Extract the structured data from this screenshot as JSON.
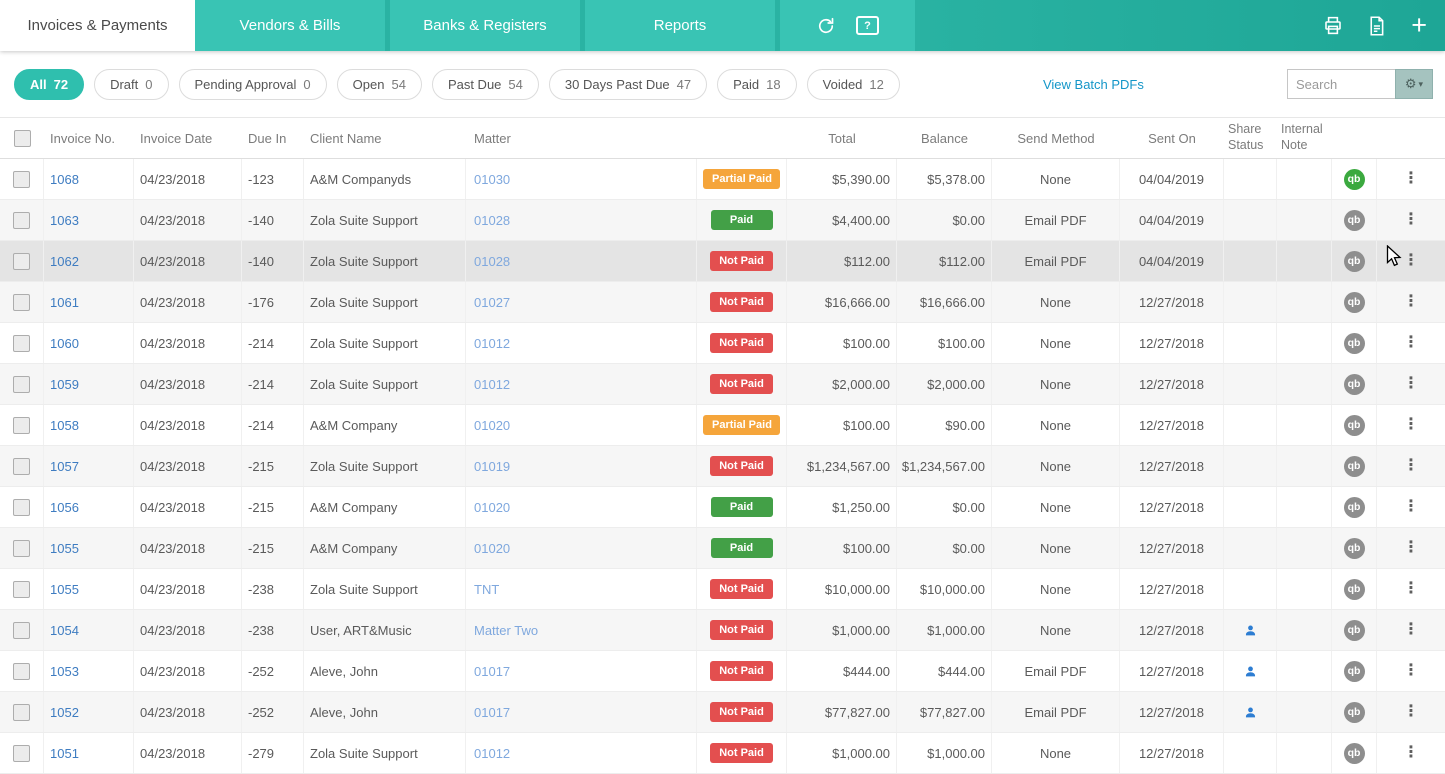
{
  "nav": {
    "tabs": [
      {
        "label": "Invoices & Payments",
        "active": true
      },
      {
        "label": "Vendors & Bills",
        "active": false
      },
      {
        "label": "Banks & Registers",
        "active": false
      },
      {
        "label": "Reports",
        "active": false
      }
    ]
  },
  "icons": {
    "help": "?",
    "add": "+",
    "qb": "qb",
    "gear": "⚙",
    "caret": "▾",
    "kebab": "⋮"
  },
  "filters": {
    "chips": [
      {
        "label": "All",
        "count": "72",
        "active": true
      },
      {
        "label": "Draft",
        "count": "0",
        "active": false
      },
      {
        "label": "Pending Approval",
        "count": "0",
        "active": false
      },
      {
        "label": "Open",
        "count": "54",
        "active": false
      },
      {
        "label": "Past Due",
        "count": "54",
        "active": false
      },
      {
        "label": "30 Days Past Due",
        "count": "47",
        "active": false
      },
      {
        "label": "Paid",
        "count": "18",
        "active": false
      },
      {
        "label": "Voided",
        "count": "12",
        "active": false
      }
    ],
    "batch_link": "View Batch PDFs",
    "search_placeholder": "Search"
  },
  "table": {
    "columns": [
      {
        "key": "checkbox",
        "label": ""
      },
      {
        "key": "invoice_no",
        "label": "Invoice No."
      },
      {
        "key": "invoice_date",
        "label": "Invoice Date"
      },
      {
        "key": "due_in",
        "label": "Due In"
      },
      {
        "key": "client",
        "label": "Client Name"
      },
      {
        "key": "matter",
        "label": "Matter"
      },
      {
        "key": "status",
        "label": ""
      },
      {
        "key": "total",
        "label": "Total"
      },
      {
        "key": "balance",
        "label": "Balance"
      },
      {
        "key": "send_method",
        "label": "Send Method"
      },
      {
        "key": "sent_on",
        "label": "Sent On"
      },
      {
        "key": "share_status",
        "label": "Share Status"
      },
      {
        "key": "internal_note",
        "label": "Internal Note"
      },
      {
        "key": "qb",
        "label": ""
      },
      {
        "key": "actions",
        "label": ""
      }
    ],
    "rows": [
      {
        "invoice_no": "1068",
        "invoice_date": "04/23/2018",
        "due_in": "-123",
        "client": "A&M Companyds",
        "matter": "01030",
        "status": "Partial Paid",
        "total": "$5,390.00",
        "balance": "$5,378.00",
        "send_method": "None",
        "sent_on": "04/04/2019",
        "shared": false,
        "qb": "green",
        "highlighted": false
      },
      {
        "invoice_no": "1063",
        "invoice_date": "04/23/2018",
        "due_in": "-140",
        "client": "Zola Suite Support",
        "matter": "01028",
        "status": "Paid",
        "total": "$4,400.00",
        "balance": "$0.00",
        "send_method": "Email PDF",
        "sent_on": "04/04/2019",
        "shared": false,
        "qb": "gray",
        "highlighted": false
      },
      {
        "invoice_no": "1062",
        "invoice_date": "04/23/2018",
        "due_in": "-140",
        "client": "Zola Suite Support",
        "matter": "01028",
        "status": "Not Paid",
        "total": "$112.00",
        "balance": "$112.00",
        "send_method": "Email PDF",
        "sent_on": "04/04/2019",
        "shared": false,
        "qb": "gray",
        "highlighted": true
      },
      {
        "invoice_no": "1061",
        "invoice_date": "04/23/2018",
        "due_in": "-176",
        "client": "Zola Suite Support",
        "matter": "01027",
        "status": "Not Paid",
        "total": "$16,666.00",
        "balance": "$16,666.00",
        "send_method": "None",
        "sent_on": "12/27/2018",
        "shared": false,
        "qb": "gray",
        "highlighted": false
      },
      {
        "invoice_no": "1060",
        "invoice_date": "04/23/2018",
        "due_in": "-214",
        "client": "Zola Suite Support",
        "matter": "01012",
        "status": "Not Paid",
        "total": "$100.00",
        "balance": "$100.00",
        "send_method": "None",
        "sent_on": "12/27/2018",
        "shared": false,
        "qb": "gray",
        "highlighted": false
      },
      {
        "invoice_no": "1059",
        "invoice_date": "04/23/2018",
        "due_in": "-214",
        "client": "Zola Suite Support",
        "matter": "01012",
        "status": "Not Paid",
        "total": "$2,000.00",
        "balance": "$2,000.00",
        "send_method": "None",
        "sent_on": "12/27/2018",
        "shared": false,
        "qb": "gray",
        "highlighted": false
      },
      {
        "invoice_no": "1058",
        "invoice_date": "04/23/2018",
        "due_in": "-214",
        "client": "A&M Company",
        "matter": "01020",
        "status": "Partial Paid",
        "total": "$100.00",
        "balance": "$90.00",
        "send_method": "None",
        "sent_on": "12/27/2018",
        "shared": false,
        "qb": "gray",
        "highlighted": false
      },
      {
        "invoice_no": "1057",
        "invoice_date": "04/23/2018",
        "due_in": "-215",
        "client": "Zola Suite Support",
        "matter": "01019",
        "status": "Not Paid",
        "total": "$1,234,567.00",
        "balance": "$1,234,567.00",
        "send_method": "None",
        "sent_on": "12/27/2018",
        "shared": false,
        "qb": "gray",
        "highlighted": false
      },
      {
        "invoice_no": "1056",
        "invoice_date": "04/23/2018",
        "due_in": "-215",
        "client": "A&M Company",
        "matter": "01020",
        "status": "Paid",
        "total": "$1,250.00",
        "balance": "$0.00",
        "send_method": "None",
        "sent_on": "12/27/2018",
        "shared": false,
        "qb": "gray",
        "highlighted": false
      },
      {
        "invoice_no": "1055",
        "invoice_date": "04/23/2018",
        "due_in": "-215",
        "client": "A&M Company",
        "matter": "01020",
        "status": "Paid",
        "total": "$100.00",
        "balance": "$0.00",
        "send_method": "None",
        "sent_on": "12/27/2018",
        "shared": false,
        "qb": "gray",
        "highlighted": false
      },
      {
        "invoice_no": "1055",
        "invoice_date": "04/23/2018",
        "due_in": "-238",
        "client": "Zola Suite Support",
        "matter": "TNT",
        "status": "Not Paid",
        "total": "$10,000.00",
        "balance": "$10,000.00",
        "send_method": "None",
        "sent_on": "12/27/2018",
        "shared": false,
        "qb": "gray",
        "highlighted": false
      },
      {
        "invoice_no": "1054",
        "invoice_date": "04/23/2018",
        "due_in": "-238",
        "client": "User, ART&Music",
        "matter": "Matter Two",
        "status": "Not Paid",
        "total": "$1,000.00",
        "balance": "$1,000.00",
        "send_method": "None",
        "sent_on": "12/27/2018",
        "shared": true,
        "qb": "gray",
        "highlighted": false
      },
      {
        "invoice_no": "1053",
        "invoice_date": "04/23/2018",
        "due_in": "-252",
        "client": "Aleve, John",
        "matter": "01017",
        "status": "Not Paid",
        "total": "$444.00",
        "balance": "$444.00",
        "send_method": "Email PDF",
        "sent_on": "12/27/2018",
        "shared": true,
        "qb": "gray",
        "highlighted": false
      },
      {
        "invoice_no": "1052",
        "invoice_date": "04/23/2018",
        "due_in": "-252",
        "client": "Aleve, John",
        "matter": "01017",
        "status": "Not Paid",
        "total": "$77,827.00",
        "balance": "$77,827.00",
        "send_method": "Email PDF",
        "sent_on": "12/27/2018",
        "shared": true,
        "qb": "gray",
        "highlighted": false
      },
      {
        "invoice_no": "1051",
        "invoice_date": "04/23/2018",
        "due_in": "-279",
        "client": "Zola Suite Support",
        "matter": "01012",
        "status": "Not Paid",
        "total": "$1,000.00",
        "balance": "$1,000.00",
        "send_method": "None",
        "sent_on": "12/27/2018",
        "shared": false,
        "qb": "gray",
        "highlighted": false
      }
    ]
  },
  "colors": {
    "nav_strip": "#2AB3A3",
    "nav_block": "#39C4B4",
    "nav_dark_1": "#29B2A2",
    "nav_dark_2": "#1EA696",
    "chip_active": "#2FBFAE",
    "link_invoice": "#3E7CC1",
    "link_matter": "#7FA8DE",
    "link_batch": "#1496C8",
    "badge_paid": "#43A047",
    "badge_not_paid": "#E34F4F",
    "badge_partial_paid": "#F5A53B",
    "qb_green": "#3BA93F",
    "qb_gray": "#8E8E8E",
    "share_icon": "#2D7DD2",
    "gear_bg": "#A5C3BF"
  }
}
